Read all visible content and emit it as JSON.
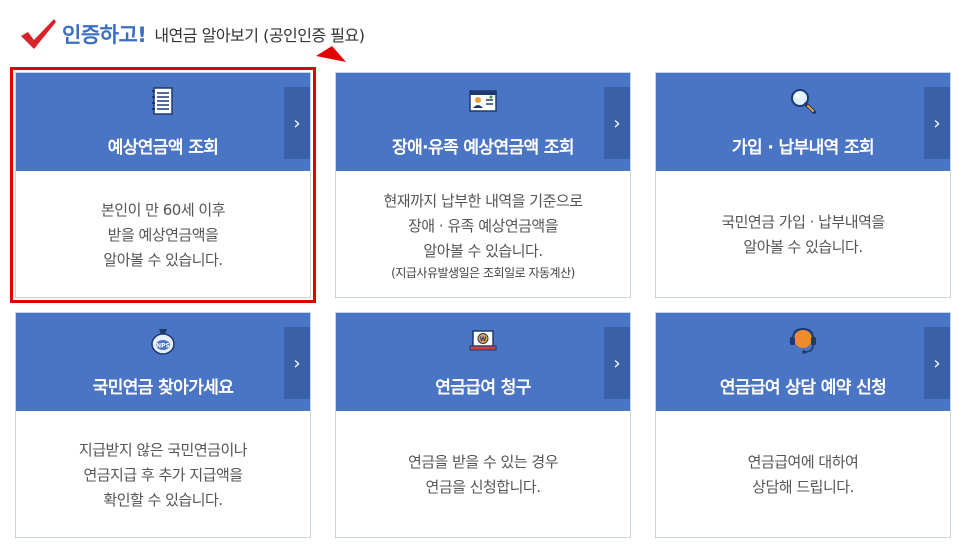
{
  "header": {
    "title": "인증하고!",
    "subtitle": "내연금 알아보기 (공인인증 필요)"
  },
  "colors": {
    "accent": "#3a6ec1",
    "card_header": "#4a74c4",
    "card_arrow": "#3a60a8",
    "highlight": "#e20000",
    "check": "#d8232a"
  },
  "cards": [
    {
      "title": "예상연금액 조회",
      "icon": "document-icon",
      "lines": [
        "본인이 만 60세 이후",
        "받을 예상연금액을",
        "알아볼 수 있습니다."
      ],
      "note": "",
      "highlighted": true
    },
    {
      "title": "장애·유족 예상연금액 조회",
      "icon": "id-card-icon",
      "lines": [
        "현재까지 납부한 내역을 기준으로",
        "장애 · 유족 예상연금액을",
        "알아볼 수 있습니다."
      ],
      "note": "(지급사유발생일은 조회일로 자동계산)"
    },
    {
      "title": "가입 · 납부내역 조회",
      "icon": "magnifier-icon",
      "lines": [
        "국민연금 가입 · 납부내역을",
        "알아볼 수 있습니다."
      ],
      "note": ""
    },
    {
      "title": "국민연금 찾아가세요",
      "icon": "nps-pouch-icon",
      "lines": [
        "지급받지 않은 국민연금이나",
        "연금지급 후 추가 지급액을",
        "확인할 수 있습니다."
      ],
      "note": ""
    },
    {
      "title": "연금급여 청구",
      "icon": "laptop-won-icon",
      "lines": [
        "연금을 받을 수 있는 경우",
        "연금을 신청합니다."
      ],
      "note": ""
    },
    {
      "title": "연금급여 상담 예약 신청",
      "icon": "headset-icon",
      "lines": [
        "연금급여에 대하여",
        "상담해 드립니다."
      ],
      "note": ""
    }
  ]
}
